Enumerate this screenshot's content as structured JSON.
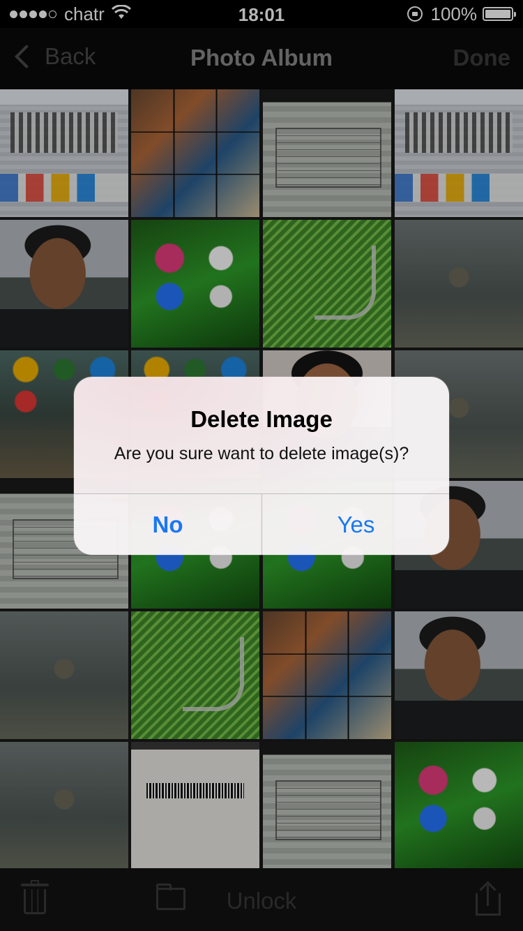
{
  "status_bar": {
    "carrier": "chatr",
    "time": "18:01",
    "battery": "100%"
  },
  "navbar": {
    "back_label": "Back",
    "title": "Photo Album",
    "done_label": "Done"
  },
  "toolbar": {
    "unlock_label": "Unlock",
    "icons": [
      "trash-icon",
      "folder-icon",
      "share-icon"
    ]
  },
  "alert": {
    "title": "Delete Image",
    "message": "Are you sure want to delete image(s)?",
    "no_label": "No",
    "yes_label": "Yes",
    "button_color": "#1a78f2"
  }
}
